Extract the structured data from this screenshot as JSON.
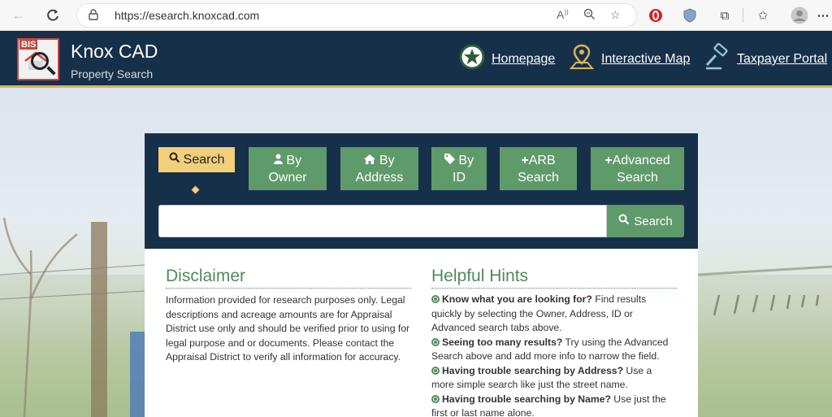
{
  "browser": {
    "url": "https://esearch.knoxcad.com",
    "icons": [
      "back-icon",
      "reload-icon",
      "lock-icon",
      "read-aloud-icon",
      "zoom-icon",
      "favorite-add-icon",
      "extension-red-icon",
      "shield-extension-icon",
      "extensions-icon",
      "favorites-icon",
      "profile-icon",
      "more-icon"
    ]
  },
  "header": {
    "logo_text": "BIS",
    "title": "Knox CAD",
    "subtitle": "Property Search",
    "links": {
      "homepage": "Homepage",
      "map": "Interactive Map",
      "taxpayer": "Taxpayer Portal"
    }
  },
  "search": {
    "tabs": {
      "search": "Search",
      "owner_line1": "By",
      "owner_line2": "Owner",
      "address_line1": "By",
      "address_line2": "Address",
      "id_line1": "By",
      "id_line2": "ID",
      "arb_line1": "ARB",
      "arb_line2": "Search",
      "adv_line1": "Advanced",
      "adv_line2": "Search"
    },
    "input_value": "",
    "button_label": "Search"
  },
  "disclaimer": {
    "title": "Disclaimer",
    "text": "Information provided for research purposes only. Legal descriptions and acreage amounts are for Appraisal District use only and should be verified prior to using for legal purpose and or documents. Please contact the Appraisal District to verify all information for accuracy."
  },
  "hints": {
    "title": "Helpful Hints",
    "items": [
      {
        "bold": "Know what you are looking for?",
        "text": " Find results quickly by selecting the Owner, Address, ID or Advanced search tabs above."
      },
      {
        "bold": "Seeing too many results?",
        "text": " Try using the Advanced Search above and add more info to narrow the field."
      },
      {
        "bold": "Having trouble searching by Address?",
        "text": " Use a more simple search like just the street name."
      },
      {
        "bold": "Having trouble searching by Name?",
        "text": " Use just the first or last name alone."
      }
    ]
  },
  "colors": {
    "header_bg": "#17304a",
    "accent_gold": "#f2cf7a",
    "tab_green": "#5f9a6a",
    "heading_green": "#4f8a5b"
  }
}
